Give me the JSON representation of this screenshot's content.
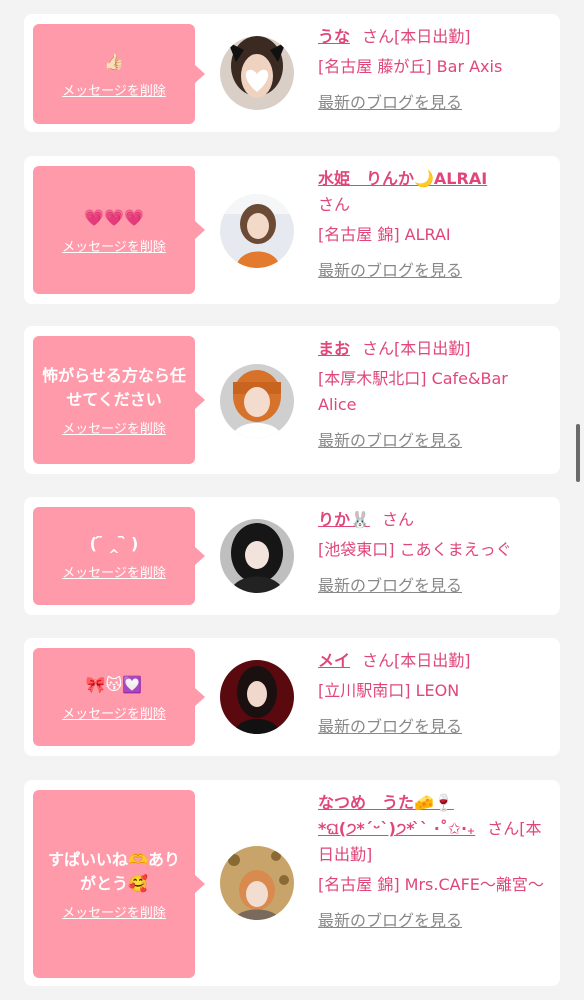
{
  "delete_label": "メッセージを削除",
  "blog_label": "最新のブログを見る",
  "colors": {
    "accent_pink": "#e0467a",
    "bubble_pink": "#ff9aaa",
    "link_gray": "#888888",
    "background": "#f3f3f3"
  },
  "cards": [
    {
      "message": "👍🏻",
      "name": "うな",
      "suffix": "さん[本日出勤]",
      "shop": "[名古屋 藤が丘] Bar Axis",
      "avatar_icon": "heart-sticker-avatar"
    },
    {
      "message": "💗💗💗",
      "name": "水姫　りんか🌙ALRAI",
      "suffix": "さん",
      "shop": "[名古屋 錦] ALRAI",
      "avatar_icon": "person-avatar"
    },
    {
      "message": "怖がらせる方なら任せてください",
      "name": "まお",
      "suffix": "さん[本日出勤]",
      "shop": "[本厚木駅北口] Cafe&Bar Alice",
      "avatar_icon": "person-avatar"
    },
    {
      "message": "( ᷇ ‸ ᷆ )",
      "name": "りか🐰",
      "suffix": "さん",
      "shop": "[池袋東口] こあくまえっぐ",
      "avatar_icon": "person-avatar"
    },
    {
      "message": "🎀😽💟",
      "name": "メイ",
      "suffix": "さん[本日出勤]",
      "shop": "[立川駅南口] LEON",
      "avatar_icon": "person-avatar"
    },
    {
      "message": "すぱいいね🫶ありがとう🥰",
      "name": "なつめ　うた🧀🍷*ଘ(੭*ˊᵕˋ)੭* ̀ˋ ·˚✩‧₊",
      "suffix": "さん[本日出勤]",
      "shop": "[名古屋 錦] Mrs.CAFE〜離宮〜",
      "avatar_icon": "person-avatar"
    }
  ]
}
